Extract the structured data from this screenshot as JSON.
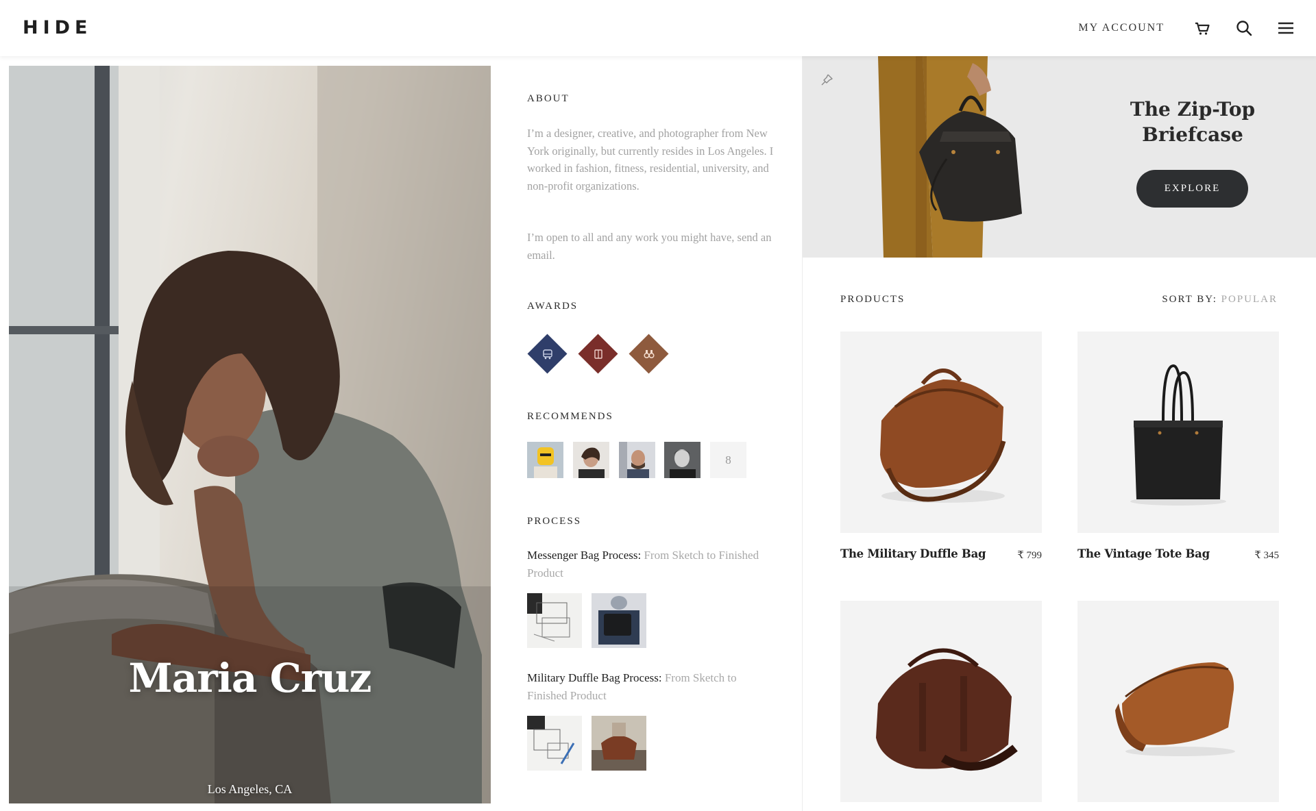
{
  "header": {
    "logo": "HIDE",
    "my_account": "MY ACCOUNT",
    "icons": [
      "cart-icon",
      "search-icon",
      "menu-icon"
    ]
  },
  "profile": {
    "name": "Maria Cruz",
    "location": "Los Angeles, CA"
  },
  "about": {
    "title": "ABOUT",
    "paragraph1": "I’m a designer, creative, and photographer from New York originally, but currently resides in Los Angeles. I worked in fashion, fitness, residential, university, and non-profit organizations.",
    "paragraph2": "I’m open to all and any work you might have, send an email."
  },
  "awards": {
    "title": "AWARDS",
    "items": [
      {
        "icon": "bus-icon",
        "color": "#2f3e6a"
      },
      {
        "icon": "book-icon",
        "color": "#7a2e2a"
      },
      {
        "icon": "binoculars-icon",
        "color": "#8e5a3d"
      }
    ]
  },
  "recommends": {
    "title": "RECOMMENDS",
    "more_count": "8"
  },
  "process": {
    "title": "PROCESS",
    "items": [
      {
        "name": "Messenger Bag Process:",
        "subtitle": "From Sketch to Finished Product"
      },
      {
        "name": "Military Duffle Bag Process:",
        "subtitle": "From Sketch to Finished Product"
      }
    ]
  },
  "promo": {
    "title": "The Zip-Top Briefcase",
    "button": "EXPLORE"
  },
  "products": {
    "title": "PRODUCTS",
    "sort_label": "SORT BY:",
    "sort_value": "POPULAR",
    "items": [
      {
        "name": "The Military Duffle Bag",
        "price": "₹ 799"
      },
      {
        "name": "The Vintage Tote Bag",
        "price": "₹ 345"
      },
      {
        "name": "",
        "price": ""
      },
      {
        "name": "",
        "price": ""
      }
    ]
  },
  "colors": {
    "accent_dark": "#2d2f31",
    "muted_text": "#a2a2a2",
    "card_bg": "#f3f3f3"
  }
}
